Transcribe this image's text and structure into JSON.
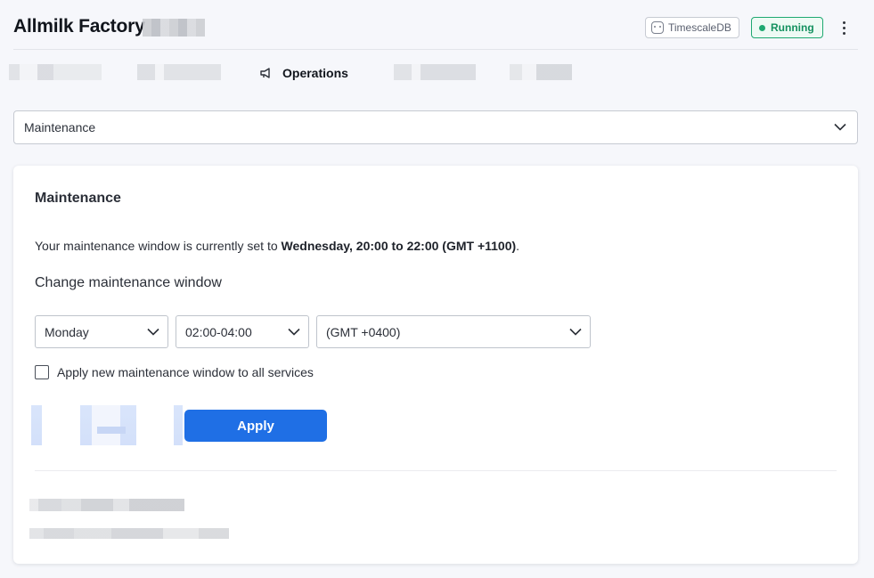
{
  "header": {
    "title": "Allmilk Factory",
    "db_badge": "TimescaleDB",
    "status_badge": "Running"
  },
  "tabs": {
    "active_label": "Operations"
  },
  "section_select": {
    "value": "Maintenance"
  },
  "maintenance": {
    "title": "Maintenance",
    "status_prefix": "Your maintenance window is currently set to ",
    "status_value": "Wednesday, 20:00 to 22:00 (GMT +1100)",
    "status_suffix": ".",
    "change_title": "Change maintenance window",
    "day_value": "Monday",
    "time_value": "02:00-04:00",
    "timezone_value": "(GMT +0400)",
    "apply_all_label": "Apply new maintenance window to all services",
    "apply_button": "Apply"
  },
  "colors": {
    "primary": "#1f6fe5",
    "running": "#1fa971",
    "background": "#f6f7fb"
  }
}
